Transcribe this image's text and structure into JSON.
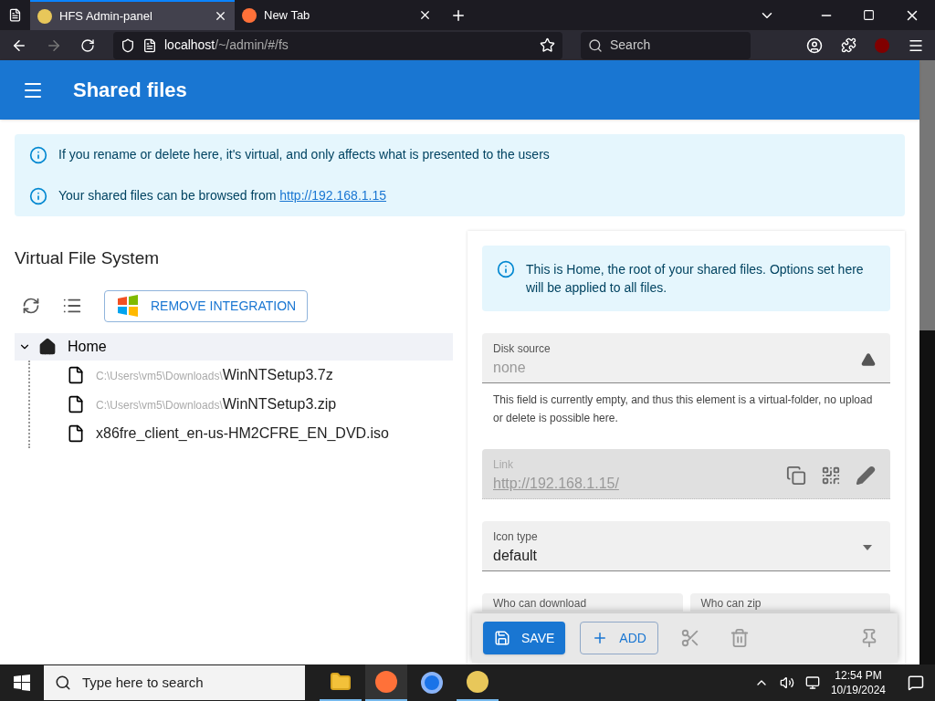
{
  "browser": {
    "tabs": [
      {
        "title": "HFS Admin-panel",
        "selected": true
      },
      {
        "title": "New Tab",
        "selected": false
      }
    ],
    "url": {
      "host": "localhost",
      "path": "/~/admin/#/fs"
    },
    "search": {
      "placeholder": "Search"
    }
  },
  "header": {
    "title": "Shared files"
  },
  "alerts": [
    {
      "text": "If you rename or delete here, it's virtual, and only affects what is presented to the users"
    },
    {
      "text": "Your shared files can be browsed from ",
      "link": "http://192.168.1.15"
    }
  ],
  "vfs": {
    "title": "Virtual File System",
    "integration_button": "REMOVE INTEGRATION",
    "tree": {
      "label": "Home",
      "expanded": true,
      "selected": true,
      "children": [
        {
          "prefix": "C:\\Users\\vm5\\Downloads\\",
          "name": "WinNTSetup3.7z"
        },
        {
          "prefix": "C:\\Users\\vm5\\Downloads\\",
          "name": "WinNTSetup3.zip"
        },
        {
          "name": "x86fre_client_en-us-HM2CFRE_EN_DVD.iso"
        }
      ]
    }
  },
  "details": {
    "info": "This is Home, the root of your shared files. Options set here will be applied to all files.",
    "fields": [
      {
        "kind": "source",
        "label": "Disk source",
        "placeholder": "none",
        "helper": "This field is currently empty, and thus this element is a virtual-folder, no upload or delete is possible here.",
        "disabled": false
      },
      {
        "kind": "link",
        "label": "Link",
        "value": "http://192.168.1.15/",
        "disabled": true
      },
      {
        "kind": "select",
        "label": "Icon type",
        "value": "default",
        "disabled": false
      }
    ],
    "permissions": [
      {
        "label": "Who can download"
      },
      {
        "label": "Who can zip"
      }
    ]
  },
  "toolbar": [
    {
      "kind": "save",
      "label": "SAVE",
      "disabled": false
    },
    {
      "kind": "add",
      "label": "ADD",
      "disabled": false
    },
    {
      "kind": "cut",
      "disabled": true
    },
    {
      "kind": "delete",
      "disabled": true
    },
    {
      "kind": "pin",
      "disabled": true
    }
  ],
  "taskbar": {
    "search_placeholder": "Type here to search",
    "time": "12:54 PM",
    "date": "10/19/2024"
  }
}
